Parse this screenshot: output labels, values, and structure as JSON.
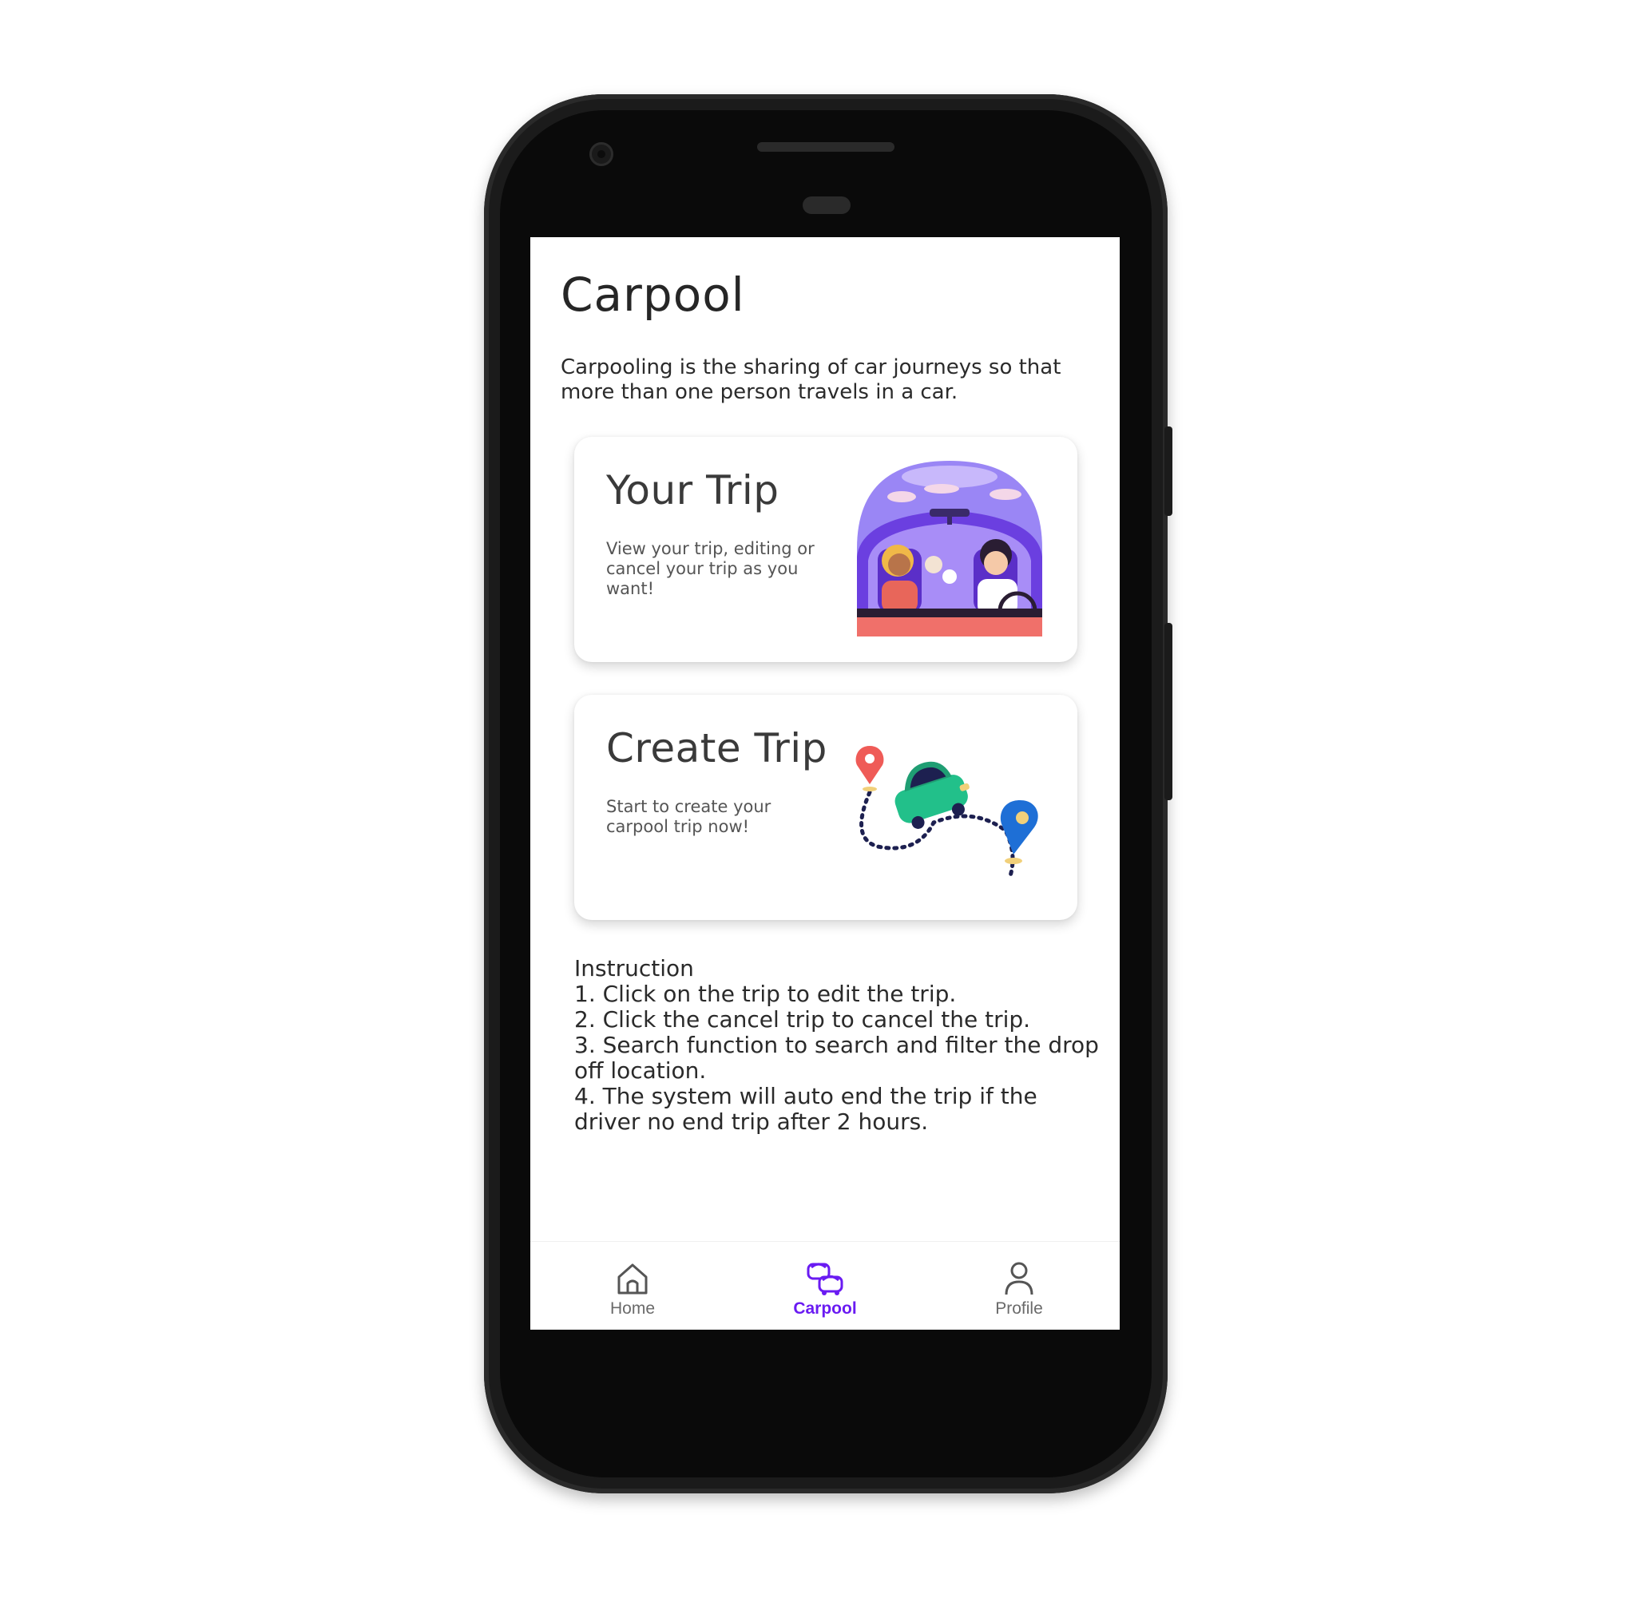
{
  "page": {
    "title": "Carpool",
    "description": "Carpooling is the sharing of car journeys so that more than one person travels in a car."
  },
  "cards": {
    "your_trip": {
      "title": "Your Trip",
      "subtitle": "View your trip, editing or cancel your trip as you want!"
    },
    "create_trip": {
      "title": "Create Trip",
      "subtitle": "Start to create your carpool trip now!"
    }
  },
  "instructions": {
    "heading": "Instruction",
    "steps": [
      "1. Click on the trip to edit the trip.",
      "2. Click the cancel trip to cancel the trip.",
      "3. Search function to search and filter the drop off location.",
      "4. The system will auto end the trip if the driver no end trip after 2 hours."
    ]
  },
  "bottom_nav": {
    "items": [
      {
        "label": "Home",
        "icon": "home-icon",
        "active": false
      },
      {
        "label": "Carpool",
        "icon": "carpool-icon",
        "active": true
      },
      {
        "label": "Profile",
        "icon": "profile-icon",
        "active": false
      }
    ]
  },
  "colors": {
    "accent": "#6a1bf2",
    "illustration_purple": "#8b6df0",
    "illustration_coral": "#f0706a",
    "car_green": "#22c08a",
    "pin_blue": "#1e6fd6",
    "pin_red": "#ef5b57"
  }
}
